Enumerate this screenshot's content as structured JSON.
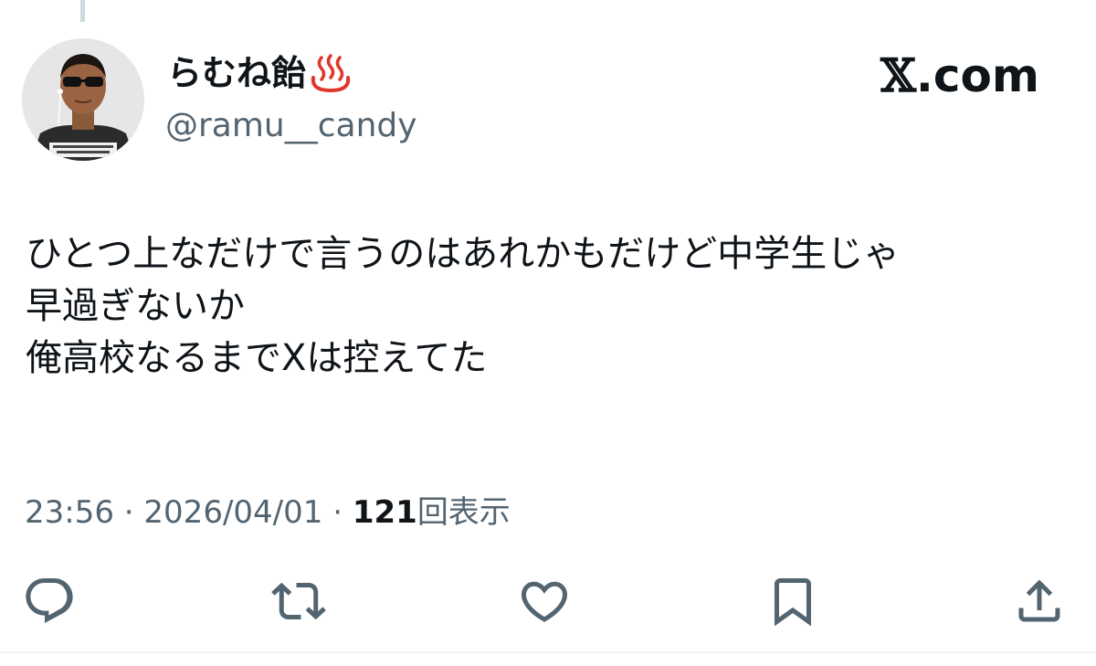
{
  "tweet": {
    "display_name": "らむね飴",
    "display_name_emoji": "hot-springs-icon",
    "handle": "@ramu__candy",
    "text_lines": [
      "ひとつ上なだけで言うのはあれかもだけど中学生じゃ",
      "早過ぎないか",
      "俺高校なるまでXは控えてた"
    ],
    "time": "23:56",
    "separator": "·",
    "date": "2026/04/01",
    "views_count": "121",
    "views_label": "回表示"
  },
  "brand": {
    "x": "𝕏",
    "domain": ".com"
  },
  "actions": {
    "reply": "reply-icon",
    "repost": "repost-icon",
    "like": "like-icon",
    "bookmark": "bookmark-icon",
    "share": "share-icon"
  },
  "colors": {
    "text": "#0f1419",
    "secondary": "#536471",
    "hotsprings": "#e0362b",
    "thread_line": "#cfd9de"
  }
}
